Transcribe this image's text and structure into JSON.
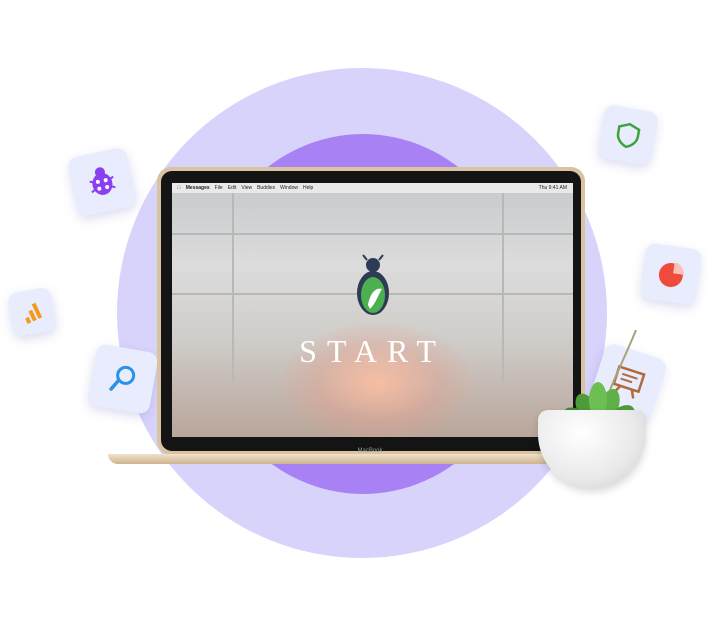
{
  "screen": {
    "start_text": "START",
    "menu": {
      "app": "Messages",
      "items": [
        "File",
        "Edit",
        "View",
        "Buddies",
        "Window",
        "Help"
      ],
      "clock": "Thu 9:41 AM"
    }
  },
  "laptop": {
    "label": "MacBook"
  },
  "icons": [
    "bug-icon",
    "shield-icon",
    "bar-chart-icon",
    "pie-chart-icon",
    "search-icon",
    "presentation-icon"
  ],
  "colors": {
    "outer_circle": "#d7d3fb",
    "inner_circle": "#a882f4",
    "accent_purple": "#8a3ff0",
    "accent_green": "#3ea33f",
    "accent_orange": "#f39a1e",
    "accent_red": "#ef4b3c",
    "accent_blue": "#2b90e8",
    "accent_brown": "#b06a3c"
  }
}
